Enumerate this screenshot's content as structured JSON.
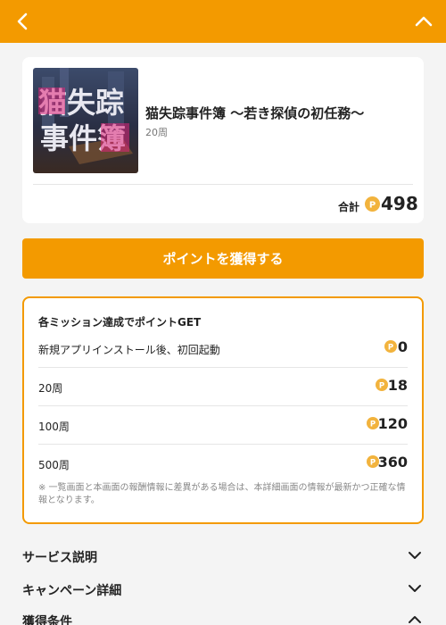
{
  "header": {
    "back_icon": "chevron-left-icon",
    "collapse_icon": "chevron-up-icon",
    "color": "#f39a00"
  },
  "game": {
    "thumb_text_line1": "猫失踪",
    "thumb_text_line2": "事件簿",
    "title": "猫失踪事件簿 〜若き探偵の初任務〜",
    "subtitle": "20周",
    "total_label": "合計",
    "total_value": "498"
  },
  "cta_label": "ポイントを獲得する",
  "missions": {
    "title": "各ミッション達成でポイントGET",
    "rows": [
      {
        "label": "新規アプリインストール後、初回起動",
        "value": "0"
      },
      {
        "label": "20周",
        "value": "18"
      },
      {
        "label": "100周",
        "value": "120"
      },
      {
        "label": "500周",
        "value": "360"
      }
    ],
    "note": "※ 一覧画面と本画面の報酬情報に差異がある場合は、本詳細画面の情報が最新かつ正確な情報となります。"
  },
  "accordions": [
    {
      "label": "サービス説明",
      "icon": "chevron-down-icon"
    },
    {
      "label": "キャンペーン詳細",
      "icon": "chevron-down-icon"
    },
    {
      "label": "獲得条件",
      "icon": "chevron-up-icon"
    }
  ],
  "colors": {
    "accent": "#f39a00",
    "coin": "#f2b33d"
  }
}
